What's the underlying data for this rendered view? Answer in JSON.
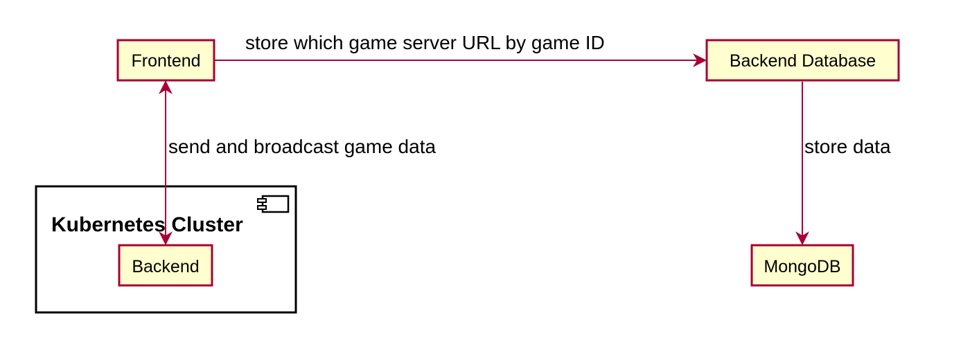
{
  "colors": {
    "node_fill": "#FEFECE",
    "node_border": "#A80036",
    "edge": "#A80036",
    "cluster_border": "#000000"
  },
  "nodes": {
    "frontend": "Frontend",
    "backend_database": "Backend Database",
    "backend": "Backend",
    "mongodb": "MongoDB"
  },
  "cluster": {
    "label": "Kubernetes Cluster",
    "icon": "component-icon"
  },
  "edges": {
    "frontend_to_backend_database": "store which game server URL by game ID",
    "frontend_backend": "send and broadcast game data",
    "backend_database_to_mongodb": "store data"
  }
}
